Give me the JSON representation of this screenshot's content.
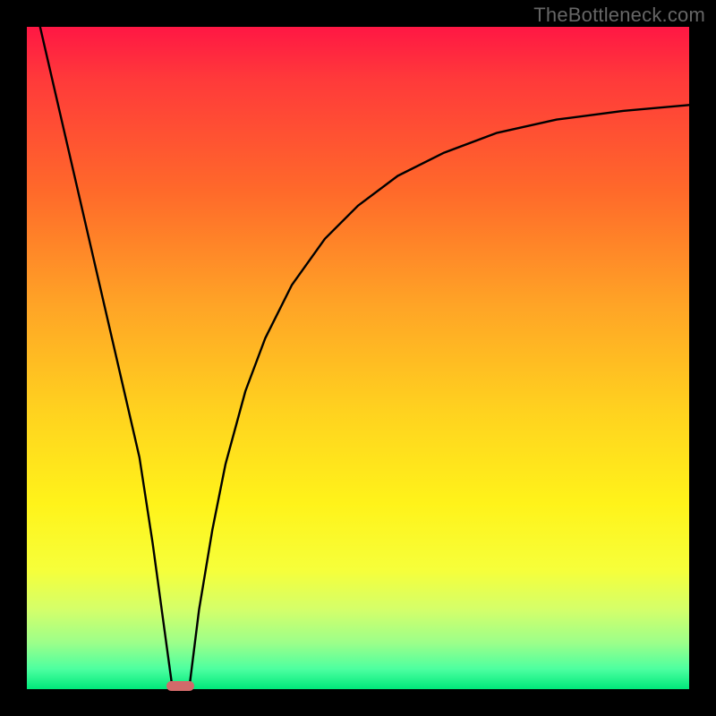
{
  "watermark": "TheBottleneck.com",
  "colors": {
    "page_bg": "#000000",
    "watermark": "#666666",
    "curve": "#000000",
    "marker": "#d26a6a"
  },
  "chart_data": {
    "type": "line",
    "title": "",
    "xlabel": "",
    "ylabel": "",
    "xlim": [
      0,
      100
    ],
    "ylim": [
      0,
      100
    ],
    "grid": false,
    "legend": false,
    "series": [
      {
        "name": "left-branch",
        "note": "Steep straight descent from top-left down to the minimum marker",
        "x": [
          2.0,
          5.0,
          8.0,
          11.0,
          14.0,
          17.0,
          19.0,
          20.5,
          22.0
        ],
        "values": [
          100.0,
          87.0,
          74.0,
          61.0,
          48.0,
          35.0,
          22.0,
          11.0,
          0.0
        ]
      },
      {
        "name": "right-branch",
        "note": "Rises sharply from the minimum then bends and levels toward upper-right",
        "x": [
          24.5,
          26.0,
          28.0,
          30.0,
          33.0,
          36.0,
          40.0,
          45.0,
          50.0,
          56.0,
          63.0,
          71.0,
          80.0,
          90.0,
          100.0
        ],
        "values": [
          0.0,
          12.0,
          24.0,
          34.0,
          45.0,
          53.0,
          61.0,
          68.0,
          73.0,
          77.5,
          81.0,
          84.0,
          86.0,
          87.3,
          88.2
        ]
      }
    ],
    "marker": {
      "note": "Small rounded pill at the bottom between the two branches, on the green band",
      "x_center": 23.2,
      "width_x_units": 4.2,
      "y": 0.0
    },
    "background_gradient_note": "Vertical gradient red→orange→yellow→green top to bottom inside thick black frame"
  }
}
